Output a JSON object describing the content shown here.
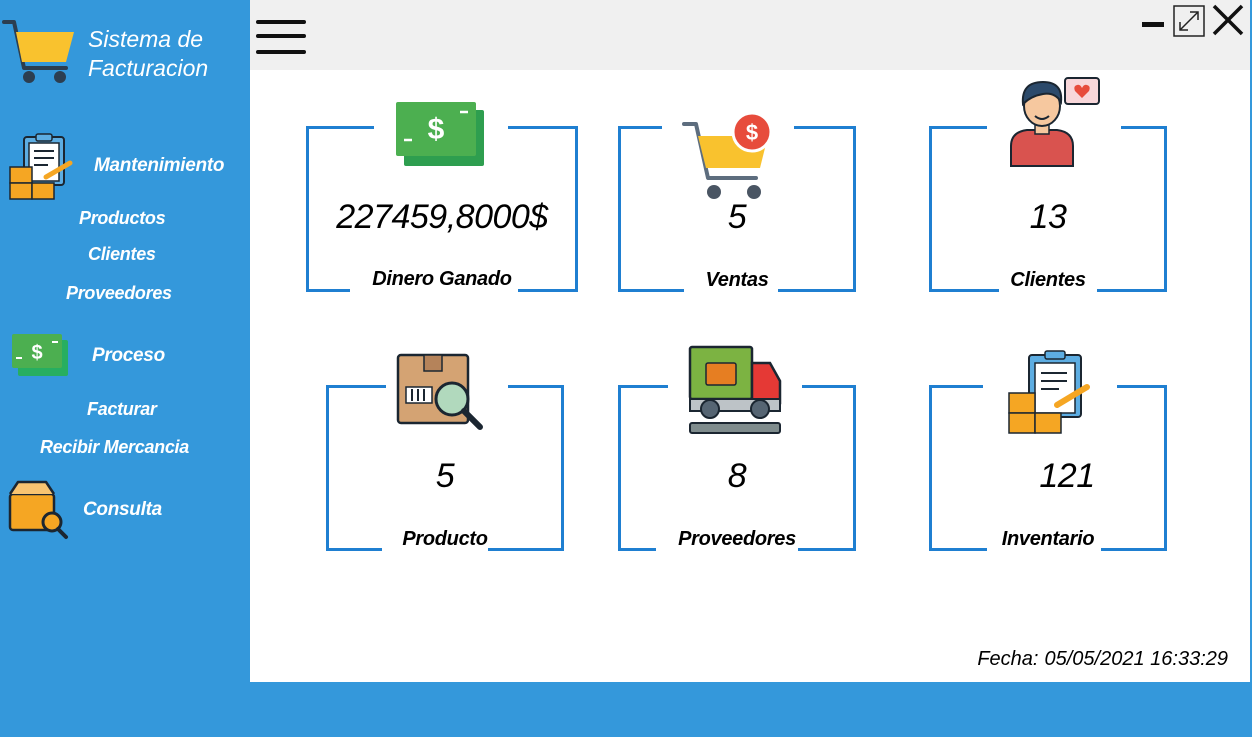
{
  "app": {
    "title": "Sistema de Facturacion"
  },
  "colors": {
    "sidebar": "#3498db",
    "accent": "#1f7fd1",
    "topbar": "#f0f0f0"
  },
  "sidebar": {
    "sections": [
      {
        "label": "Mantenimiento",
        "icon": "clipboard-boxes-icon",
        "items": [
          "Productos",
          "Clientes",
          "Proveedores"
        ]
      },
      {
        "label": "Proceso",
        "icon": "money-icon",
        "items": [
          "Facturar",
          "Recibir Mercancia"
        ]
      },
      {
        "label": "Consulta",
        "icon": "box-search-icon",
        "items": []
      }
    ]
  },
  "topbar": {
    "menu_icon": "hamburger-menu-icon",
    "window_controls": [
      "minimize-icon",
      "maximize-icon",
      "close-icon"
    ]
  },
  "cards": [
    {
      "value": "227459,8000$",
      "label": "Dinero Ganado",
      "icon": "money-icon"
    },
    {
      "value": "5",
      "label": "Ventas",
      "icon": "cart-dollar-icon"
    },
    {
      "value": "13",
      "label": "Clientes",
      "icon": "customer-icon"
    },
    {
      "value": "5",
      "label": "Producto",
      "icon": "box-search-icon"
    },
    {
      "value": "8",
      "label": "Proveedores",
      "icon": "delivery-truck-icon"
    },
    {
      "value": "121",
      "label": "Inventario",
      "icon": "clipboard-boxes-icon"
    }
  ],
  "footer": {
    "date_label": "Fecha:",
    "date_value": "05/05/2021 16:33:29"
  }
}
